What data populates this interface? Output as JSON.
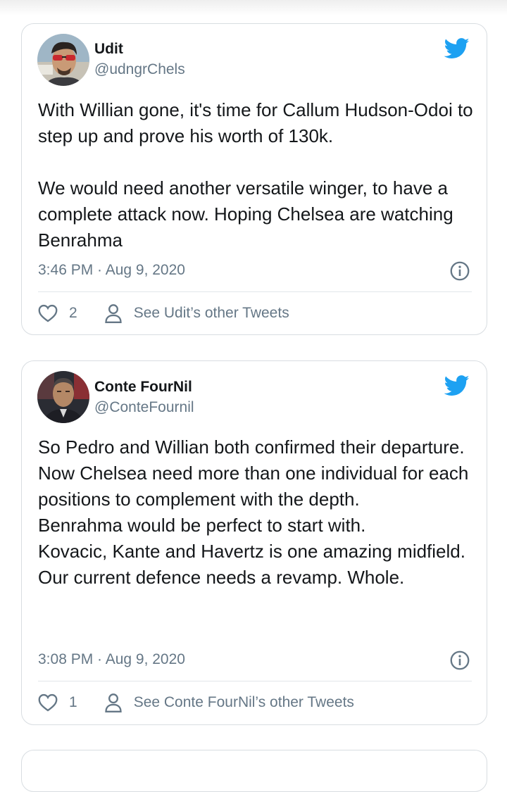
{
  "tweets": [
    {
      "display_name": "Udit",
      "handle": "@udngrChels",
      "paragraphs": [
        "With Willian gone, it's time for Callum Hudson-Odoi to step up and prove his worth of 130k.",
        "",
        "We would need another versatile winger, to have a complete attack now. Hoping Chelsea are watching Benrahma"
      ],
      "timestamp": "3:46 PM · Aug 9, 2020",
      "like_count": "2",
      "other_tweets_label": "See Udit’s other Tweets"
    },
    {
      "display_name": "Conte FourNil",
      "handle": "@ConteFournil",
      "paragraphs": [
        "So Pedro and Willian both confirmed their departure.",
        "Now Chelsea need more than one individual for each positions to complement with the depth.",
        "Benrahma would be perfect to start with.",
        "Kovacic, Kante and Havertz is one amazing midfield.",
        "Our current defence needs a revamp. Whole."
      ],
      "timestamp": "3:08 PM · Aug 9, 2020",
      "like_count": "1",
      "other_tweets_label": "See Conte FourNil’s other Tweets"
    }
  ],
  "icons": {
    "brand": "twitter-bird-icon",
    "info": "info-icon",
    "like": "heart-icon",
    "profile": "person-icon"
  },
  "colors": {
    "twitter_blue": "#1da1f2",
    "text_primary": "#14171a",
    "text_secondary": "#657786",
    "border": "#d8dde1"
  }
}
